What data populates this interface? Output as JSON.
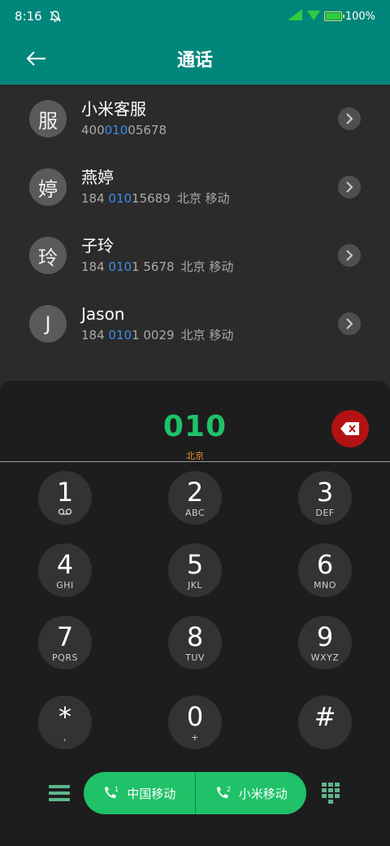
{
  "status_bar": {
    "time": "8:16",
    "battery_text": "100%",
    "battery_level_percent": 100,
    "icons": [
      "bell-off-icon",
      "signal-icon",
      "wifi-icon",
      "battery-icon"
    ]
  },
  "header": {
    "title": "通话",
    "back_icon": "arrow-left-icon"
  },
  "contacts": [
    {
      "avatar": "服",
      "name": "小米客服",
      "number_pre": "400",
      "number_hl": "010",
      "number_post": "05678",
      "location": ""
    },
    {
      "avatar": "婷",
      "name": "燕婷",
      "number_pre": "184 ",
      "number_hl": "010",
      "number_post": "15689",
      "location": "北京 移动"
    },
    {
      "avatar": "玲",
      "name": "子玲",
      "number_pre": "184 ",
      "number_hl": "010",
      "number_post": "1 5678",
      "location": "北京 移动"
    },
    {
      "avatar": "J",
      "name": "Jason",
      "number_pre": "184 ",
      "number_hl": "010",
      "number_post": "1 0029",
      "location": "北京 移动"
    }
  ],
  "dialer": {
    "input": "010",
    "location": "北京",
    "keys": [
      {
        "digit": "1",
        "letters": "ꝏ"
      },
      {
        "digit": "2",
        "letters": "ABC"
      },
      {
        "digit": "3",
        "letters": "DEF"
      },
      {
        "digit": "4",
        "letters": "GHI"
      },
      {
        "digit": "5",
        "letters": "JKL"
      },
      {
        "digit": "6",
        "letters": "MNO"
      },
      {
        "digit": "7",
        "letters": "PQRS"
      },
      {
        "digit": "8",
        "letters": "TUV"
      },
      {
        "digit": "9",
        "letters": "WXYZ"
      },
      {
        "digit": "*",
        "letters": ","
      },
      {
        "digit": "0",
        "letters": "+"
      },
      {
        "digit": "#",
        "letters": ""
      }
    ]
  },
  "call_buttons": {
    "sim1_label": "中国移动",
    "sim2_label": "小米移动",
    "sim1_badge": "1",
    "sim2_badge": "2"
  },
  "colors": {
    "header_bg": "#00867a",
    "accent_green": "#1fc268",
    "highlight_blue": "#3b8ee8",
    "location_orange": "#e8922e",
    "delete_red": "#b31212"
  }
}
